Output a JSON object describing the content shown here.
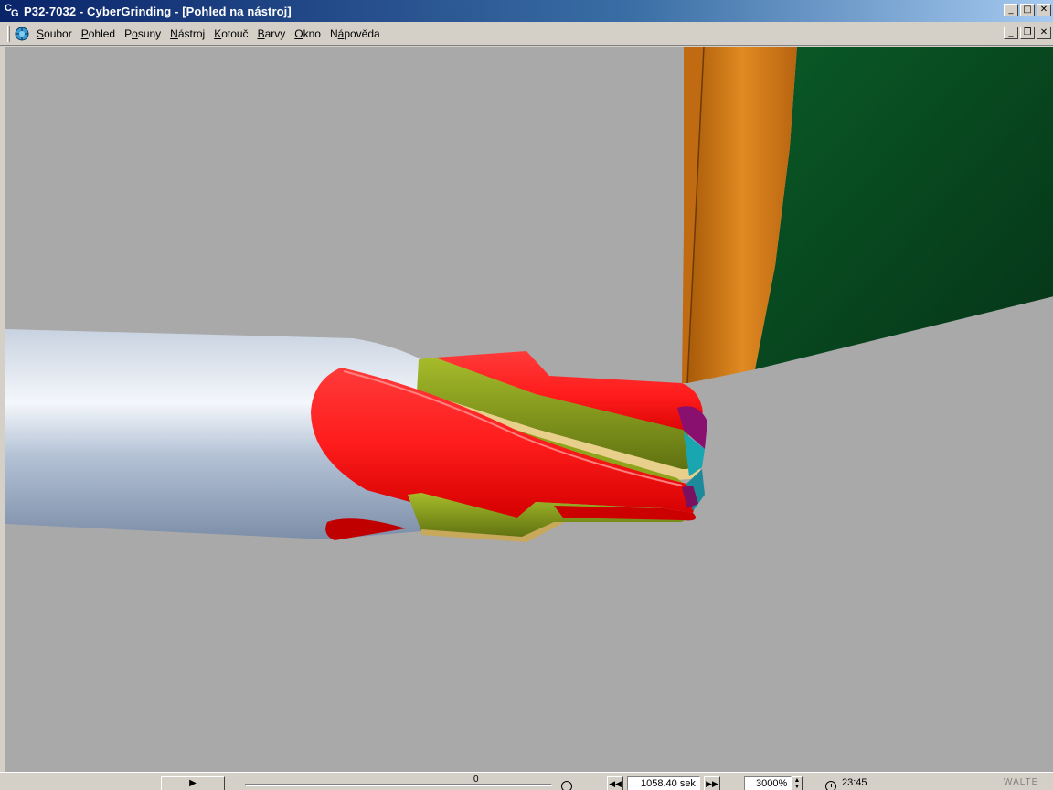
{
  "window": {
    "title": "P32-7032 - CyberGrinding - [Pohled na nástroj]",
    "icon_letters": [
      "C",
      "G"
    ],
    "buttons": {
      "minimize": "_",
      "maximize": "□",
      "close": "✕"
    }
  },
  "menu": {
    "items": [
      {
        "key": "S",
        "rest": "oubor"
      },
      {
        "key": "P",
        "rest": "ohled"
      },
      {
        "pre": "P",
        "key": "o",
        "rest": "suny"
      },
      {
        "key": "N",
        "rest": "ástroj"
      },
      {
        "key": "K",
        "rest": "otouč"
      },
      {
        "key": "B",
        "rest": "arvy"
      },
      {
        "key": "O",
        "rest": "kno"
      },
      {
        "pre": "N",
        "key": "á",
        "rest": "pověda"
      }
    ],
    "mdi_buttons": {
      "minimize": "_",
      "restore": "❐",
      "close": "✕"
    }
  },
  "status": {
    "play": "▶",
    "slider_value": "0",
    "rewind": "◀◀",
    "forward": "▶▶",
    "time": "1058.40 sek",
    "zoom": "3000%",
    "spin_up": "▲",
    "spin_down": "▼",
    "clock": "23:45",
    "brand": "WALTE"
  },
  "colors": {
    "background": "#a9a9a9",
    "shank": "#a4b4cc",
    "flute": "#ff2020",
    "land": "#8ea41c",
    "grinding_wheel_face": "#0b5a2a",
    "grinding_wheel_rim": "#d07a18"
  }
}
